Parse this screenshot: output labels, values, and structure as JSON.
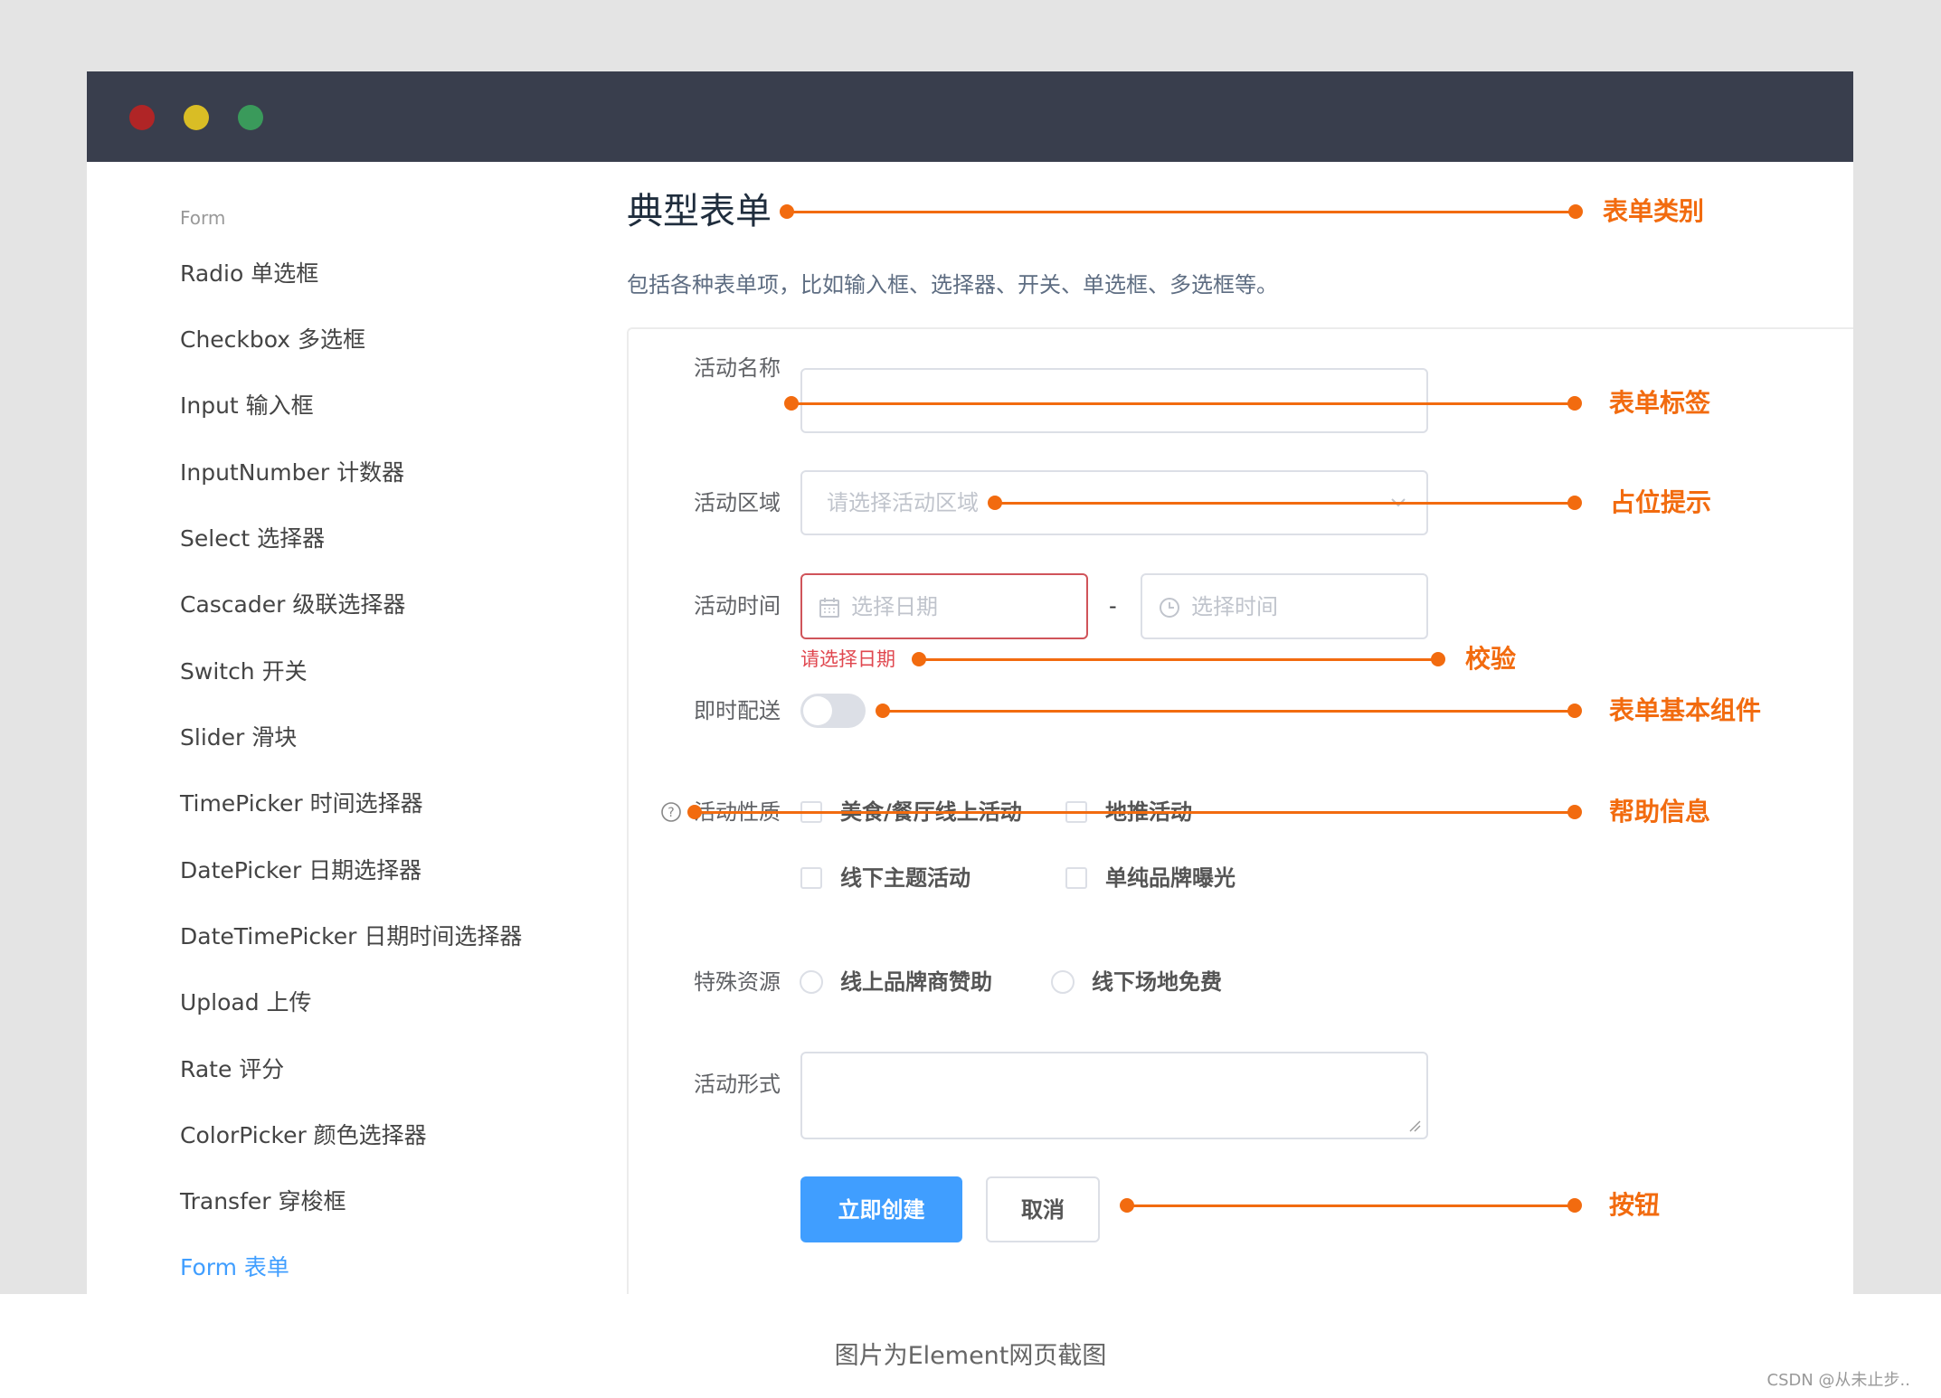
{
  "window": {
    "controls": [
      "close",
      "minimize",
      "maximize"
    ]
  },
  "sidebar": {
    "header": "Form",
    "items": [
      {
        "label": "Radio 单选框"
      },
      {
        "label": "Checkbox 多选框"
      },
      {
        "label": "Input 输入框"
      },
      {
        "label": "InputNumber 计数器"
      },
      {
        "label": "Select 选择器"
      },
      {
        "label": "Cascader 级联选择器"
      },
      {
        "label": "Switch 开关"
      },
      {
        "label": "Slider 滑块"
      },
      {
        "label": "TimePicker 时间选择器"
      },
      {
        "label": "DatePicker 日期选择器"
      },
      {
        "label": "DateTimePicker 日期时间选择器"
      },
      {
        "label": "Upload 上传"
      },
      {
        "label": "Rate 评分"
      },
      {
        "label": "ColorPicker 颜色选择器"
      },
      {
        "label": "Transfer 穿梭框"
      },
      {
        "label": "Form 表单",
        "active": true
      }
    ]
  },
  "main": {
    "title": "典型表单",
    "description": "包括各种表单项，比如输入框、选择器、开关、单选框、多选框等。"
  },
  "form": {
    "name": {
      "label": "活动名称",
      "value": ""
    },
    "region": {
      "label": "活动区域",
      "placeholder": "请选择活动区域",
      "icon": "chevron-down-icon"
    },
    "time": {
      "label": "活动时间",
      "date_placeholder": "选择日期",
      "date_icon": "calendar-icon",
      "separator": "-",
      "time_placeholder": "选择时间",
      "time_icon": "clock-icon",
      "error": "请选择日期"
    },
    "delivery": {
      "label": "即时配送",
      "on": false
    },
    "type": {
      "label": "活动性质",
      "help_icon": "question-circle-icon",
      "options": [
        {
          "label": "美食/餐厅线上活动",
          "checked": false
        },
        {
          "label": "地推活动",
          "checked": false
        },
        {
          "label": "线下主题活动",
          "checked": false
        },
        {
          "label": "单纯品牌曝光",
          "checked": false
        }
      ]
    },
    "resource": {
      "label": "特殊资源",
      "options": [
        {
          "label": "线上品牌商赞助",
          "selected": false
        },
        {
          "label": "线下场地免费",
          "selected": false
        }
      ]
    },
    "desc": {
      "label": "活动形式",
      "value": ""
    },
    "submit_label": "立即创建",
    "cancel_label": "取消"
  },
  "annotations": {
    "color": "#f26b0f",
    "items": [
      {
        "label": "表单类别"
      },
      {
        "label": "表单标签"
      },
      {
        "label": "占位提示"
      },
      {
        "label": "校验"
      },
      {
        "label": "表单基本组件"
      },
      {
        "label": "帮助信息"
      },
      {
        "label": "按钮"
      }
    ]
  },
  "caption": "图片为Element网页截图",
  "watermark": "CSDN @从未止步.."
}
